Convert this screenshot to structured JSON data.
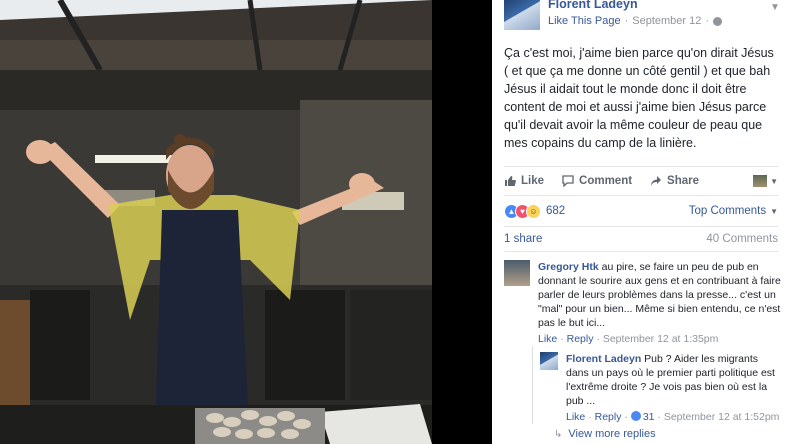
{
  "post": {
    "page_name": "Florent Ladeyn",
    "like_page": "Like This Page",
    "separator": "·",
    "date": "September 12",
    "text": "Ça c'est moi, j'aime bien parce qu'on dirait Jésus ( et que ça me donne un côté gentil ) et que bah Jésus il aidait tout le monde donc il doit être content de moi et aussi j'aime bien Jésus parce qu'il devait avoir la même couleur de peau que mes copains du camp de la linière."
  },
  "actions": {
    "like": "Like",
    "comment": "Comment",
    "share": "Share"
  },
  "reactions": {
    "count": "682",
    "top_comments": "Top Comments"
  },
  "stats": {
    "shares": "1 share",
    "comments": "40 Comments"
  },
  "comments": [
    {
      "author": "Gregory Htk",
      "text": " au pire, se faire un peu de pub en donnant le sourire aux gens et en contribuant à faire parler de leurs problèmes dans la presse... c'est un \"mal\" pour un bien... Même si bien entendu, ce n'est pas le but ici...",
      "like": "Like",
      "reply": "Reply",
      "dot": "·",
      "time": "September 12 at 1:35pm"
    }
  ],
  "reply": {
    "author": "Florent Ladeyn",
    "text": " Pub ? Aider les migrants dans un pays où le premier parti politique est l'extrême droite ? Je vois pas bien où est la pub ...",
    "like": "Like",
    "reply": "Reply",
    "dot": "·",
    "likes": "31",
    "time": "September 12 at 1:52pm"
  },
  "more_replies": "View more replies",
  "colors": {
    "link": "#365899",
    "muted": "#90949c",
    "text": "#1d2129"
  }
}
